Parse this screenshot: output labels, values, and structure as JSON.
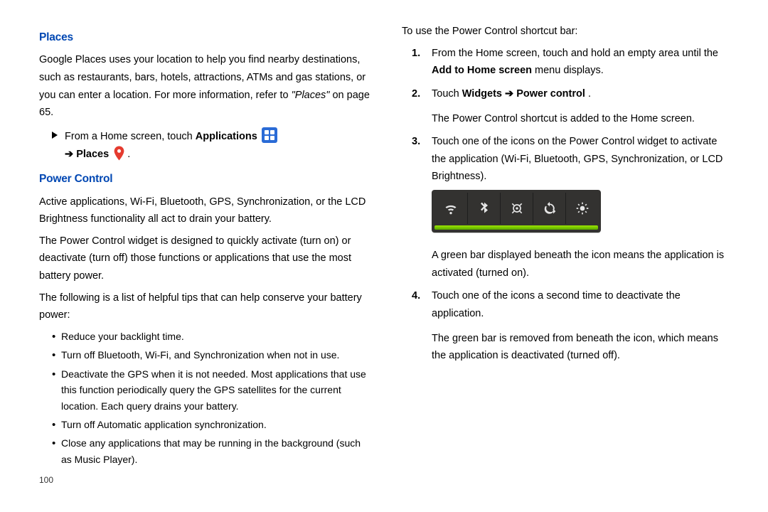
{
  "left": {
    "places": {
      "heading": "Places",
      "p1_a": "Google Places uses your location to help you find nearby destinations, such as restaurants, bars, hotels, attractions, ATMs and gas stations, or you can enter a location. For more information, refer to ",
      "p1_ref_italic": "\"Places\" ",
      "p1_ref_tail": " on page 65.",
      "instr_a": "From a Home screen, touch ",
      "instr_apps": "Applications",
      "instr_arrow": " ➔ ",
      "instr_places": "Places",
      "instr_period": " ."
    },
    "power": {
      "heading": "Power Control",
      "p1": "Active applications, Wi-Fi, Bluetooth, GPS, Synchronization, or the LCD Brightness functionality all act to drain your battery.",
      "p2": "The Power Control widget is designed to quickly activate (turn on) or deactivate (turn off) those functions or applications that use the most battery power.",
      "p3": "The following is a list of helpful tips that can help conserve your battery power:",
      "tips": [
        "Reduce your backlight time.",
        "Turn off Bluetooth, Wi-Fi, and Synchronization when not in use.",
        "Deactivate the GPS when it is not needed. Most applications that use this function periodically query the GPS satellites for the current location. Each query drains your battery.",
        "Turn off Automatic application synchronization.",
        "Close any applications that may be running in the background (such as Music Player)."
      ]
    },
    "pageNum": "100"
  },
  "right": {
    "intro": "To use the Power Control shortcut bar:",
    "steps": {
      "s1_a": "From the Home screen, touch and hold an empty area until the ",
      "s1_bold": "Add to Home screen",
      "s1_b": " menu displays.",
      "s2_a": "Touch ",
      "s2_bold1": "Widgets",
      "s2_arrow": " ➔ ",
      "s2_bold2": "Power control",
      "s2_period": ".",
      "s2_sub": "The Power Control shortcut is added to the Home screen.",
      "s3_a": "Touch one of the icons on the Power Control widget to activate the application (Wi-Fi, Bluetooth, GPS, Synchronization, or LCD Brightness).",
      "s3_sub": "A green bar displayed beneath the icon means the application is activated (turned on).",
      "s4_a": "Touch one of the icons a second time to deactivate the application.",
      "s4_sub": "The green bar is removed from beneath the icon, which means the application is deactivated (turned off)."
    },
    "nums": {
      "n1": "1.",
      "n2": "2.",
      "n3": "3.",
      "n4": "4."
    }
  }
}
